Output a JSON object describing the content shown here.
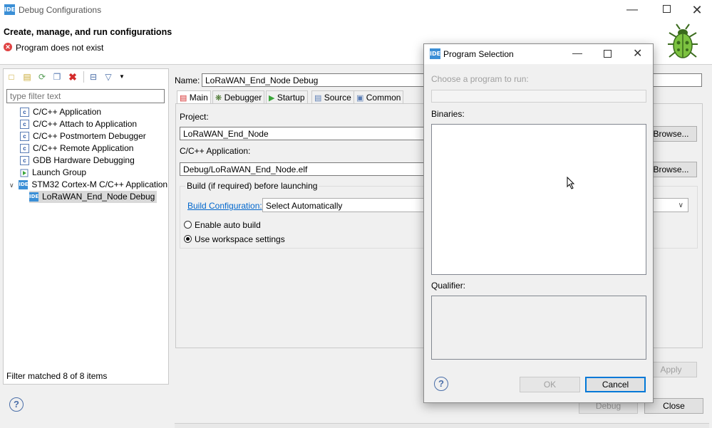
{
  "window": {
    "title": "Debug Configurations",
    "heading": "Create, manage, and run configurations",
    "error_message": "Program does not exist"
  },
  "sidebar": {
    "filter_placeholder": "type filter text",
    "items": [
      {
        "label": "C/C++ Application"
      },
      {
        "label": "C/C++ Attach to Application"
      },
      {
        "label": "C/C++ Postmortem Debugger"
      },
      {
        "label": "C/C++ Remote Application"
      },
      {
        "label": "GDB Hardware Debugging"
      },
      {
        "label": "Launch Group"
      },
      {
        "label": "STM32 Cortex-M C/C++ Application"
      },
      {
        "label": "LoRaWAN_End_Node Debug"
      }
    ],
    "status": "Filter matched 8 of 8 items"
  },
  "main": {
    "name_label": "Name:",
    "name_value": "LoRaWAN_End_Node Debug",
    "tabs": [
      {
        "label": "Main"
      },
      {
        "label": "Debugger"
      },
      {
        "label": "Startup"
      },
      {
        "label": "Source"
      },
      {
        "label": "Common"
      }
    ],
    "project_label": "Project:",
    "project_value": "LoRaWAN_End_Node",
    "browse_label": "Browse...",
    "application_label": "C/C++ Application:",
    "application_value": "Debug/LoRaWAN_End_Node.elf",
    "build_group_label": "Build (if required) before launching",
    "build_config_link": "Build Configuration:",
    "build_config_value": "Select Automatically",
    "radio_auto_build": "Enable auto build",
    "radio_workspace": "Use workspace settings",
    "apply_label": "Apply",
    "debug_label": "Debug",
    "close_label": "Close"
  },
  "dialog": {
    "title": "Program Selection",
    "choose_label": "Choose a program to run:",
    "binaries_label": "Binaries:",
    "qualifier_label": "Qualifier:",
    "ok_label": "OK",
    "cancel_label": "Cancel"
  },
  "icons": {
    "app": "ide-badge",
    "error": "error-icon",
    "bug": "bug-icon",
    "help": "help-icon"
  },
  "colors": {
    "accent": "#3b8fd6",
    "error": "#e04343",
    "link": "#0066cc",
    "selection": "#d9d9d9"
  }
}
